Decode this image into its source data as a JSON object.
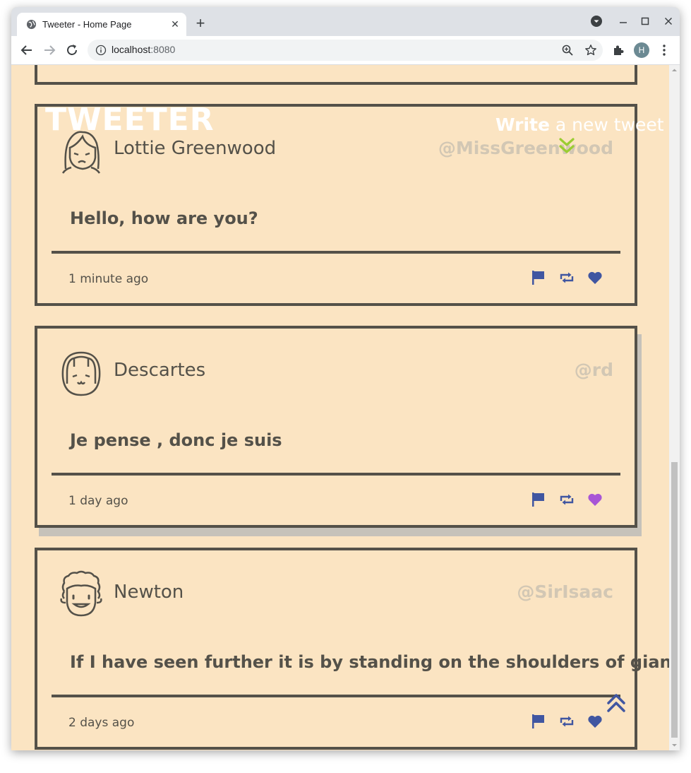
{
  "browser": {
    "tab_title": "Tweeter - Home Page",
    "tab_close": "✕",
    "new_tab": "+",
    "url_host": "localhost",
    "url_port": ":8080",
    "profile_initial": "H"
  },
  "header": {
    "brand": "TWEETER",
    "compose_bold": "Write",
    "compose_rest": " a new tweet"
  },
  "tweets": [
    {
      "name": "Lottie Greenwood",
      "handle": "@MissGreenwood",
      "text": "Hello, how are you?",
      "time": "1 minute ago",
      "liked": false,
      "avatar": "woman-avatar-icon"
    },
    {
      "name": "Descartes",
      "handle": "@rd",
      "text": "Je pense , donc je suis",
      "time": "1 day ago",
      "liked": true,
      "avatar": "girl-bangs-avatar-icon"
    },
    {
      "name": "Newton",
      "handle": "@SirIsaac",
      "text": "If I have seen further it is by standing on the shoulders of giants",
      "time": "2 days ago",
      "liked": false,
      "avatar": "curly-hair-avatar-icon"
    }
  ],
  "colors": {
    "page_bg": "#fbe4c2",
    "border": "#545149",
    "handle": "#d2c7b4",
    "action_blue": "#4056a1",
    "liked_purple": "#a855d6",
    "compose_arrow": "#9acd32"
  }
}
